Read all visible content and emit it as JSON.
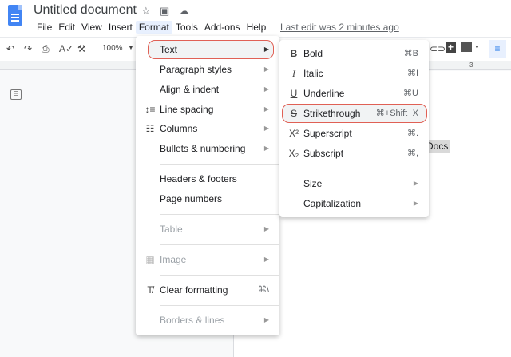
{
  "header": {
    "title": "Untitled document",
    "last_edit": "Last edit was 2 minutes ago",
    "menus": [
      "File",
      "Edit",
      "View",
      "Insert",
      "Format",
      "Tools",
      "Add-ons",
      "Help"
    ],
    "active_menu": "Format"
  },
  "toolbar": {
    "zoom": "100%",
    "ruler_mark": "3"
  },
  "document": {
    "visible_text": "Docs"
  },
  "format_menu": {
    "items": [
      {
        "label": "Text"
      },
      {
        "label": "Paragraph styles"
      },
      {
        "label": "Align & indent"
      },
      {
        "label": "Line spacing"
      },
      {
        "label": "Columns"
      },
      {
        "label": "Bullets & numbering"
      },
      {
        "label": "Headers & footers"
      },
      {
        "label": "Page numbers"
      },
      {
        "label": "Table"
      },
      {
        "label": "Image"
      },
      {
        "label": "Clear formatting",
        "shortcut": "⌘\\"
      },
      {
        "label": "Borders & lines"
      }
    ]
  },
  "text_submenu": {
    "items": [
      {
        "label": "Bold",
        "shortcut": "⌘B"
      },
      {
        "label": "Italic",
        "shortcut": "⌘I"
      },
      {
        "label": "Underline",
        "shortcut": "⌘U"
      },
      {
        "label": "Strikethrough",
        "shortcut": "⌘+Shift+X"
      },
      {
        "label": "Superscript",
        "shortcut": "⌘."
      },
      {
        "label": "Subscript",
        "shortcut": "⌘,"
      },
      {
        "label": "Size"
      },
      {
        "label": "Capitalization"
      }
    ]
  },
  "colors": {
    "highlight_border": "#e06055",
    "accent": "#4285f4"
  }
}
